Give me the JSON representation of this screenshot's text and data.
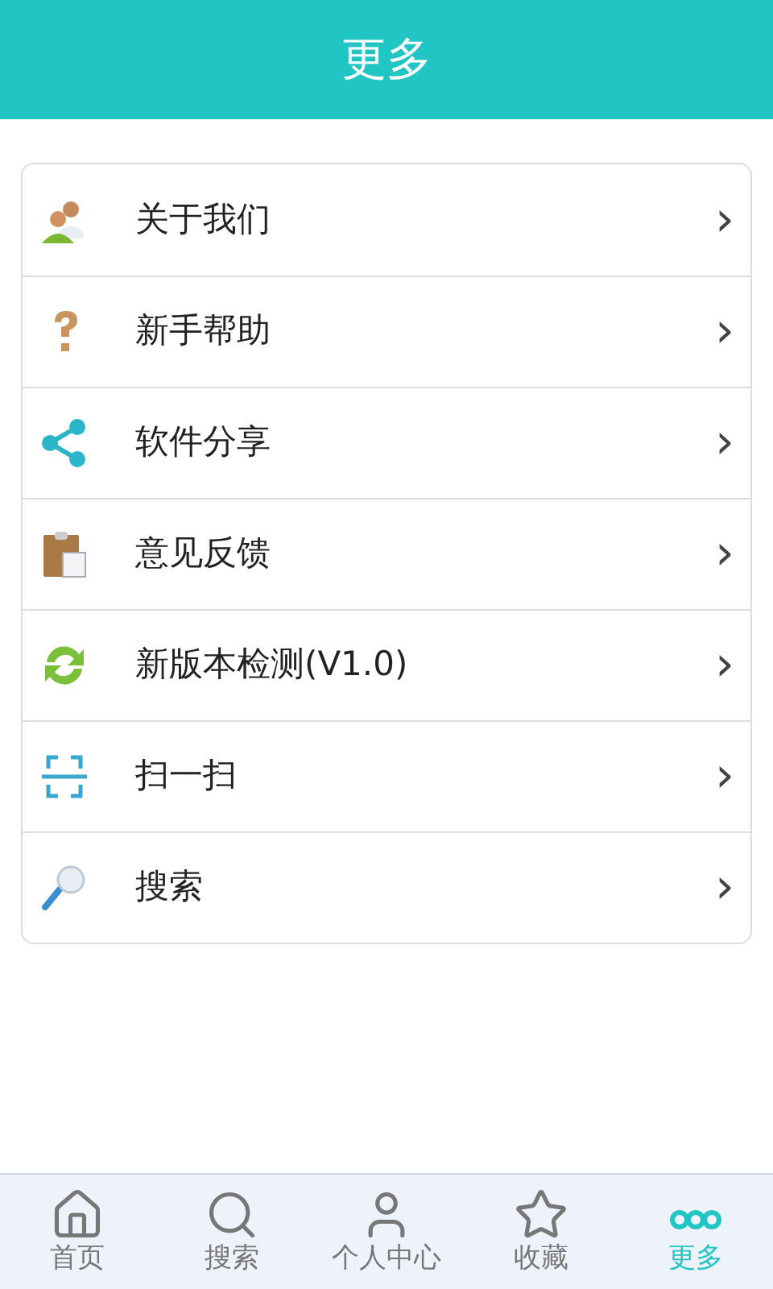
{
  "header": {
    "title": "更多"
  },
  "menu": [
    {
      "kind": "users",
      "label": "关于我们",
      "chevron": "›"
    },
    {
      "kind": "question",
      "label": "新手帮助",
      "chevron": "›"
    },
    {
      "kind": "share",
      "label": "软件分享",
      "chevron": "›"
    },
    {
      "kind": "clipboard",
      "label": "意见反馈",
      "chevron": "›"
    },
    {
      "kind": "refresh",
      "label": "新版本检测(V1.0)",
      "chevron": "›"
    },
    {
      "kind": "scan",
      "label": "扫一扫",
      "chevron": "›"
    },
    {
      "kind": "magnifier",
      "label": "搜索",
      "chevron": "›"
    }
  ],
  "tabs": [
    {
      "kind": "home",
      "label": "首页",
      "selected": false
    },
    {
      "kind": "search",
      "label": "搜索",
      "selected": false
    },
    {
      "kind": "user",
      "label": "个人中心",
      "selected": false
    },
    {
      "kind": "star",
      "label": "收藏",
      "selected": false
    },
    {
      "kind": "more",
      "label": "更多",
      "selected": true
    }
  ]
}
